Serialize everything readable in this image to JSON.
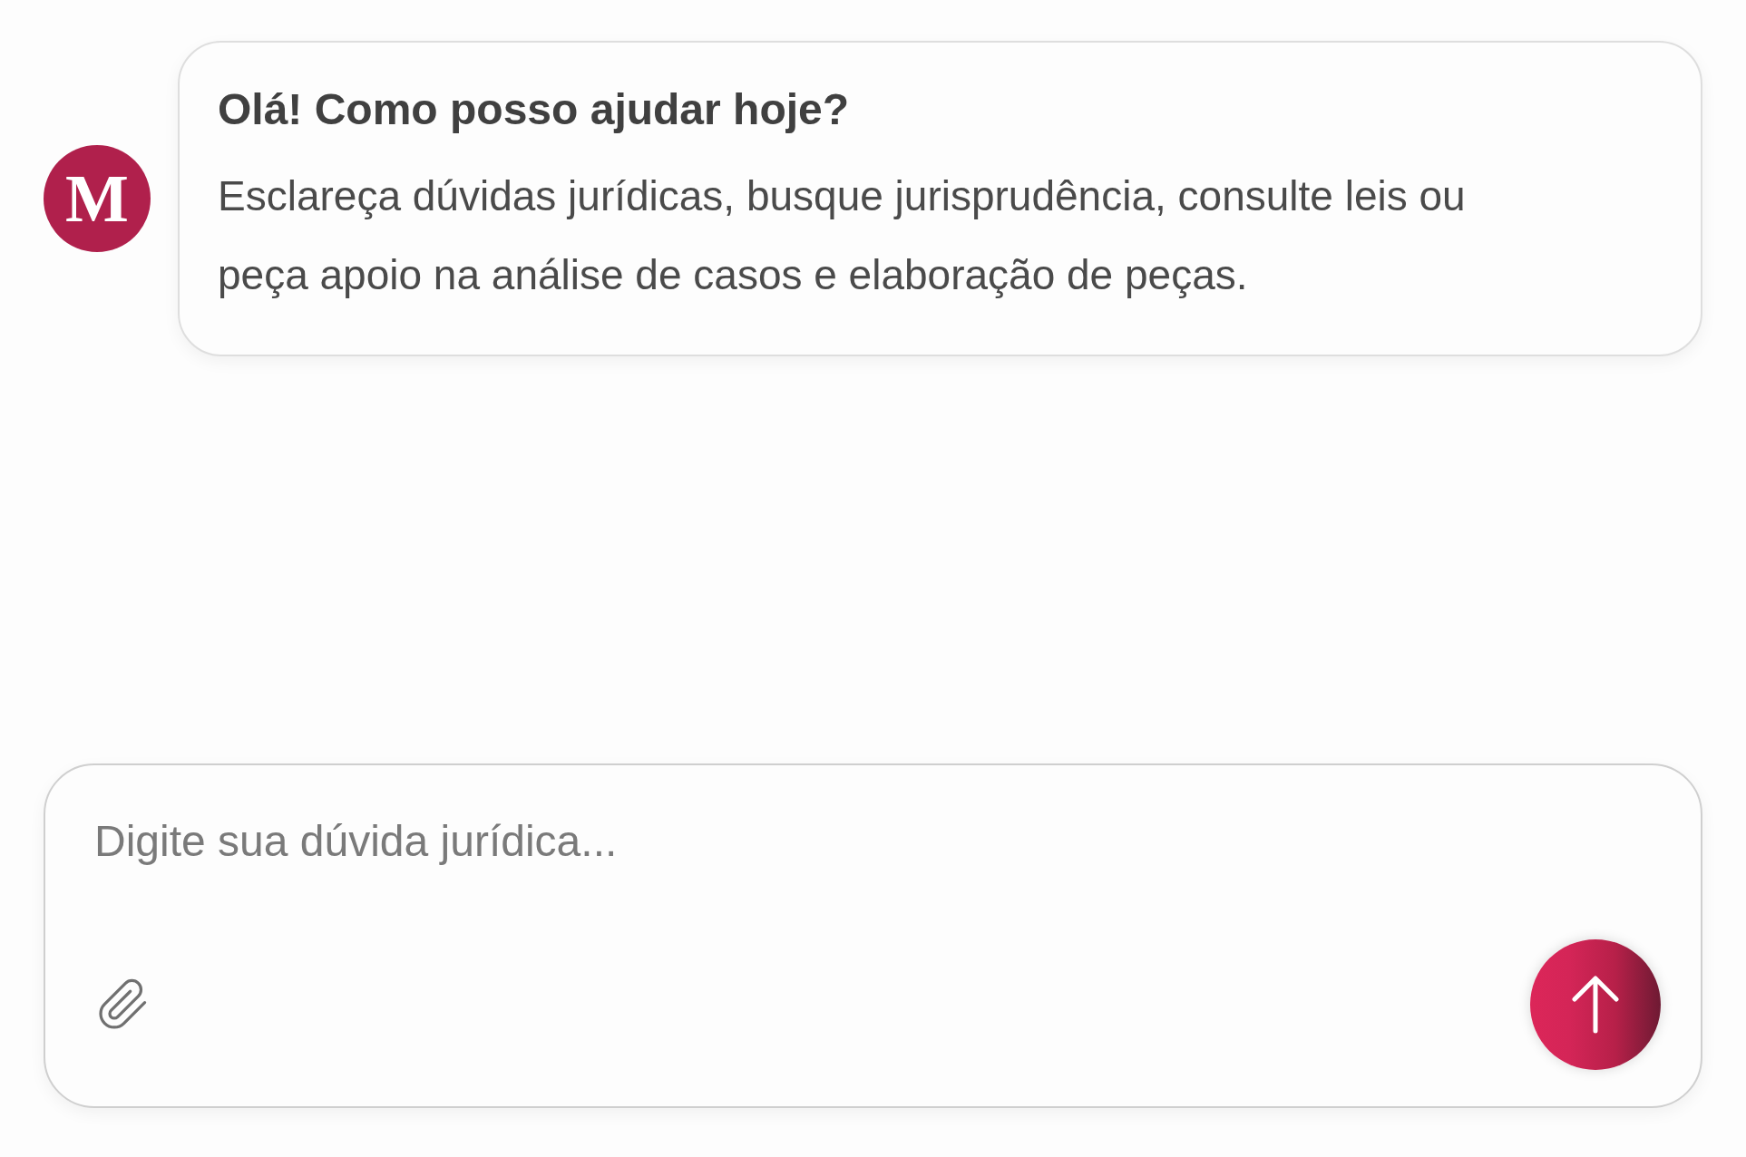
{
  "assistant": {
    "avatar_letter": "M",
    "title": "Olá! Como posso ajudar hoje?",
    "message": "Esclareça dúvidas jurídicas, busque jurisprudência, consulte leis ou peça apoio na análise de casos e elaboração de peças."
  },
  "composer": {
    "placeholder": "Digite sua dúvida jurídica..."
  }
}
